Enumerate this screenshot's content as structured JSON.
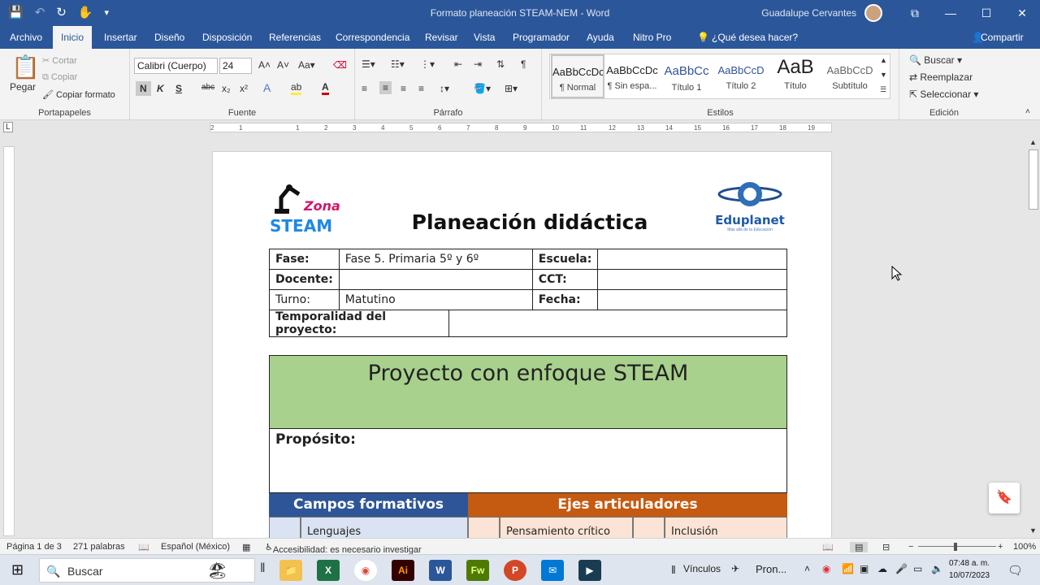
{
  "title_bar": {
    "document_title": "Formato planeación STEAM-NEM  -  Word",
    "user": "Guadalupe Cervantes",
    "buttons": {
      "minimize": "—",
      "maximize": "☐",
      "close": "✕",
      "ribbon_display": "⧉"
    }
  },
  "tabs": [
    "Archivo",
    "Inicio",
    "Insertar",
    "Diseño",
    "Disposición",
    "Referencias",
    "Correspondencia",
    "Revisar",
    "Vista",
    "Programador",
    "Ayuda",
    "Nitro Pro",
    "¿Qué desea hacer?",
    "Compartir"
  ],
  "active_tab": "Inicio",
  "ribbon": {
    "clipboard": {
      "paste": "Pegar",
      "cut": "Cortar",
      "copy": "Copiar",
      "format_painter": "Copiar formato",
      "label": "Portapapeles"
    },
    "font": {
      "family": "Calibri (Cuerpo)",
      "size": "24",
      "bold": "N",
      "italic": "K",
      "underline": "S",
      "strike": "abc",
      "sub": "x₂",
      "sup": "x²",
      "label": "Fuente"
    },
    "paragraph": {
      "label": "Párrafo"
    },
    "styles": {
      "items": [
        {
          "preview": "AaBbCcDc",
          "name": "¶ Normal"
        },
        {
          "preview": "AaBbCcDc",
          "name": "¶ Sin espa..."
        },
        {
          "preview": "AaBbCc",
          "name": "Título 1"
        },
        {
          "preview": "AaBbCcD",
          "name": "Título 2"
        },
        {
          "preview": "AaB",
          "name": "Título"
        },
        {
          "preview": "AaBbCcD",
          "name": "Subtítulo"
        }
      ],
      "label": "Estilos"
    },
    "editing": {
      "find": "Buscar",
      "replace": "Reemplazar",
      "select": "Seleccionar",
      "label": "Edición"
    }
  },
  "document": {
    "logo_left": {
      "line1": "Zona",
      "line2": "STEAM"
    },
    "logo_right": {
      "name": "Eduplanet",
      "tagline": "Más allá de la Educación"
    },
    "page_title": "Planeación didáctica",
    "info_table": {
      "fase_label": "Fase:",
      "fase_value": "Fase 5. Primaria 5º y 6º",
      "escuela_label": "Escuela:",
      "escuela_value": "",
      "docente_label": "Docente:",
      "docente_value": "",
      "cct_label": "CCT:",
      "cct_value": "",
      "turno_label": "Turno:",
      "turno_value": "Matutino",
      "fecha_label": "Fecha:",
      "fecha_value": "",
      "temporalidad_label": "Temporalidad del proyecto:",
      "temporalidad_value": ""
    },
    "project_heading": "Proyecto con enfoque STEAM",
    "proposito_label": "Propósito:",
    "campos_heading": "Campos formativos",
    "ejes_heading": "Ejes articuladores",
    "row_items": [
      "Lenguajes",
      "Pensamiento crítico",
      "Inclusión"
    ]
  },
  "status_bar": {
    "page": "Página 1 de 3",
    "words": "271 palabras",
    "language": "Español (México)",
    "accessibility": "Accesibilidad: es necesario investigar",
    "zoom": "100%"
  },
  "taskbar": {
    "search_placeholder": "Buscar",
    "apps": [
      "Explorador",
      "Excel",
      "Chrome",
      "Illustrator",
      "Word",
      "Fireworks",
      "PowerPoint",
      "Correo",
      "Otro"
    ],
    "links": "Vínculos",
    "weather": "Pron...",
    "time": "07:48 a. m.",
    "date": "10/07/2023"
  },
  "colors": {
    "word_blue": "#2b579a",
    "green_header": "#a9d18e",
    "campos_blue": "#2e5597",
    "ejes_orange": "#c55a11"
  }
}
